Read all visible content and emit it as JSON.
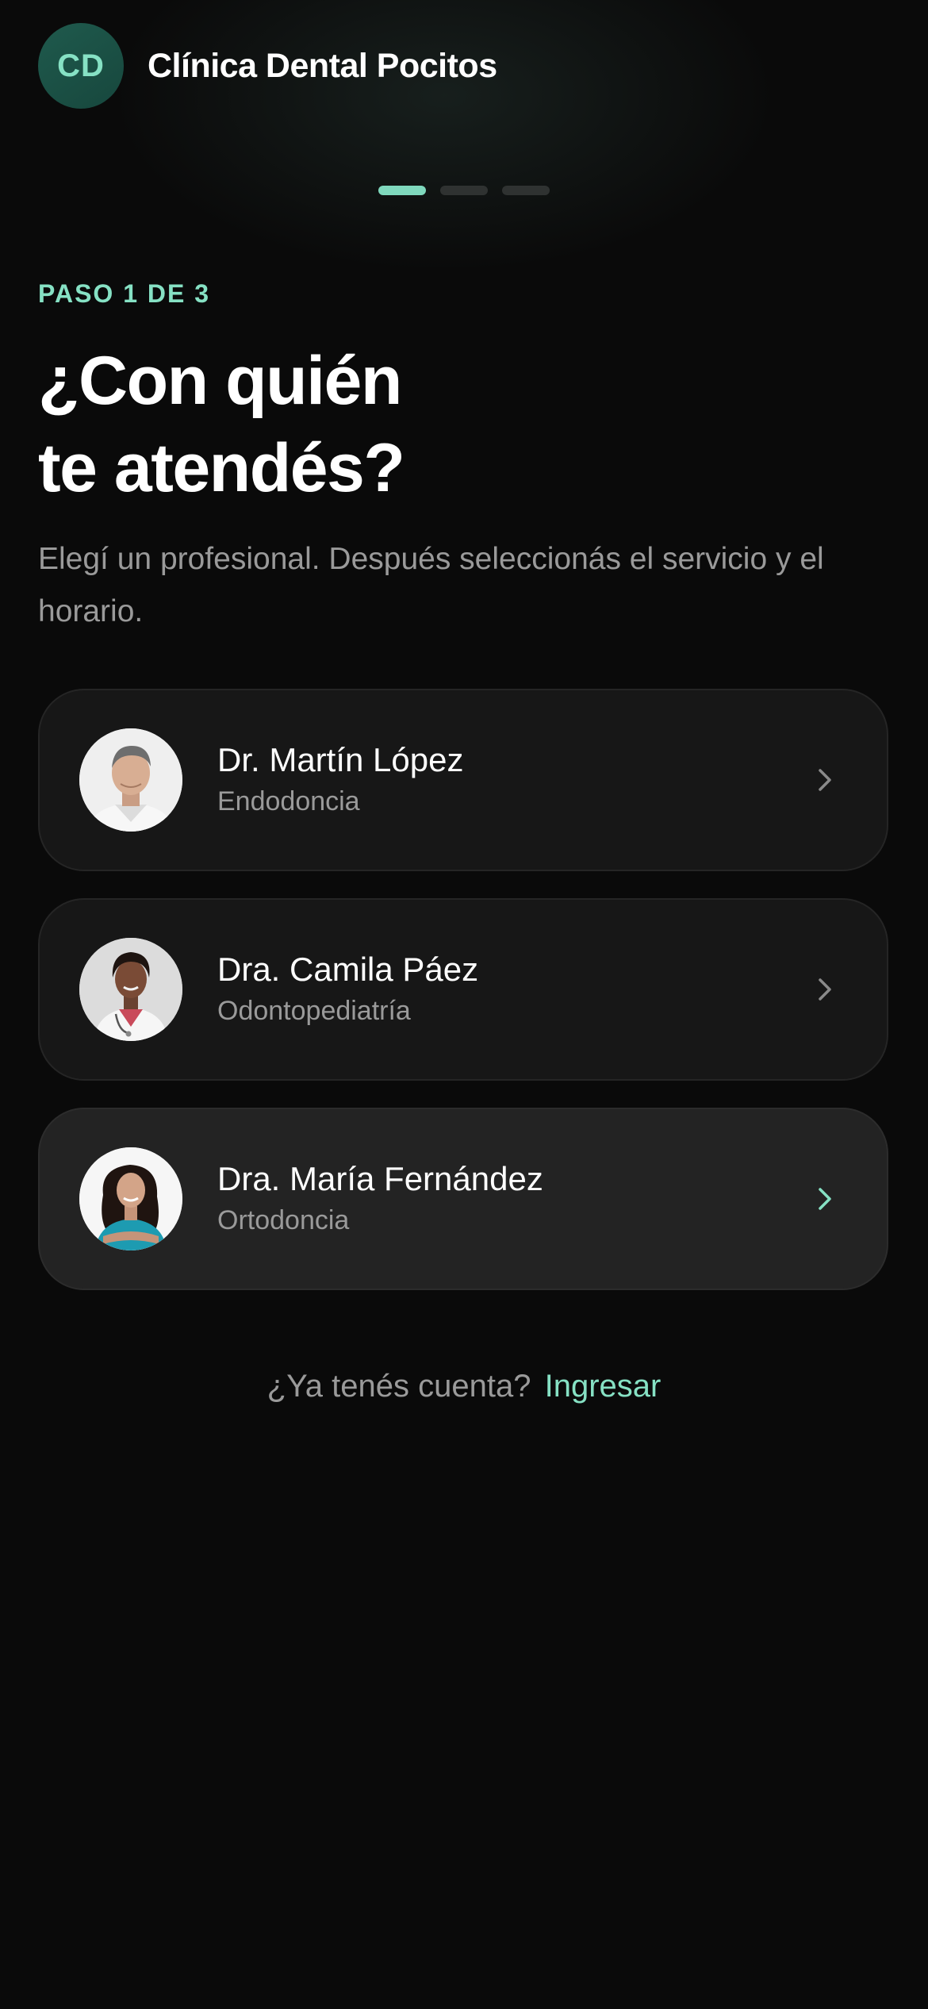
{
  "header": {
    "logo_initials": "CD",
    "clinic_name": "Clínica Dental Pocitos"
  },
  "progress": {
    "total_steps": 3,
    "current_step": 1
  },
  "step_label": "PASO 1 DE 3",
  "title_line1": "¿Con quién",
  "title_line2": "te atendés?",
  "subtitle": "Elegí un profesional. Después seleccionás el servicio y el horario.",
  "doctors": [
    {
      "name": "Dr. Martín López",
      "specialty": "Endodoncia",
      "selected": false
    },
    {
      "name": "Dra. Camila Páez",
      "specialty": "Odontopediatría",
      "selected": false
    },
    {
      "name": "Dra. María Fernández",
      "specialty": "Ortodoncia",
      "selected": true
    }
  ],
  "footer": {
    "question": "¿Ya tenés cuenta?",
    "login_link": "Ingresar"
  },
  "colors": {
    "accent": "#86e1c4",
    "background": "#0a0a0a",
    "card": "#171717",
    "card_selected": "#232323"
  }
}
